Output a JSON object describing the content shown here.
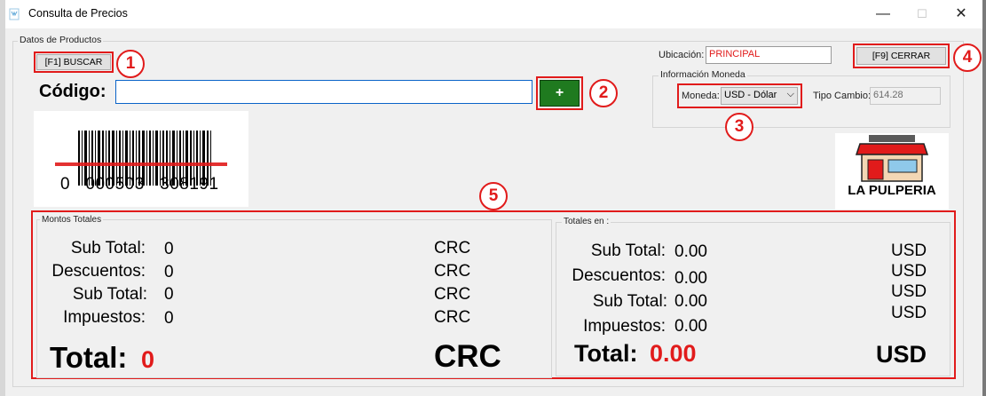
{
  "window": {
    "title": "Consulta de Precios",
    "minimize_glyph": "—",
    "maximize_glyph": "☐",
    "close_glyph": "✕"
  },
  "groups": {
    "productos_label": "Datos de Productos",
    "moneda_label": "Información Moneda",
    "montos_label": "Montos Totales",
    "totales_en_label": "Totales en :"
  },
  "toolbar": {
    "buscar_label": "[F1] BUSCAR",
    "cerrar_label": "[F9] CERRAR",
    "add_label": "+"
  },
  "codigo": {
    "label": "Código:",
    "value": ""
  },
  "ubicacion": {
    "label": "Ubicación:",
    "value": "PRINCIPAL"
  },
  "moneda": {
    "label": "Moneda:",
    "selected": "USD - Dólar",
    "tipo_cambio_label": "Tipo Cambio:",
    "tipo_cambio_value": "614.28"
  },
  "barcode": {
    "digits": "0   000503   308191"
  },
  "logo": {
    "text": "LA PULPERIA"
  },
  "badges": [
    "1",
    "2",
    "3",
    "4",
    "5"
  ],
  "montos_crc": {
    "rows": [
      {
        "label": "Sub Total:",
        "value": "0",
        "currency": "CRC"
      },
      {
        "label": "Descuentos:",
        "value": "0",
        "currency": "CRC"
      },
      {
        "label": "Sub Total:",
        "value": "0",
        "currency": "CRC"
      },
      {
        "label": "Impuestos:",
        "value": "0",
        "currency": "CRC"
      }
    ],
    "total_label": "Total:",
    "total_value": "0",
    "total_currency": "CRC"
  },
  "montos_usd": {
    "rows": [
      {
        "label": "Sub Total:",
        "value": "0.00",
        "currency": "USD"
      },
      {
        "label": "Descuentos:",
        "value": "0.00",
        "currency": "USD"
      },
      {
        "label": "Sub Total:",
        "value": "0.00",
        "currency": "USD"
      },
      {
        "label": "Impuestos:",
        "value": "0.00",
        "currency": "USD"
      }
    ],
    "total_label": "Total:",
    "total_value": "0.00",
    "total_currency": "USD"
  },
  "colors": {
    "annotation_red": "#e11b1b",
    "add_button_green": "#1f7a1f",
    "total_value_red": "#e11b1b"
  }
}
